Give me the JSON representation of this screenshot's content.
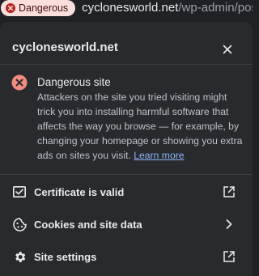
{
  "omnibox": {
    "chip_label": "Dangerous",
    "url_host": "cyclonesworld.net",
    "url_path": "/wp-admin/post"
  },
  "panel": {
    "site_title": "cyclonesworld.net",
    "warning": {
      "title": "Dangerous site",
      "description": "Attackers on the site you tried visiting might trick you into installing harmful software that affects the way you browse — for example, by changing your homepage or showing you extra ads on sites you visit.",
      "learn_more": "Learn more"
    },
    "rows": [
      {
        "label": "Certificate is valid",
        "icon": "certificate-icon",
        "trail": "open-external-icon"
      },
      {
        "label": "Cookies and site data",
        "icon": "cookie-icon",
        "trail": "chevron-right-icon"
      },
      {
        "label": "Site settings",
        "icon": "gear-icon",
        "trail": "open-external-icon"
      }
    ]
  },
  "colors": {
    "background": "#202124",
    "panel": "#292a2d",
    "danger_chip_bg": "#f9dedc",
    "danger_icon": "#f28b82",
    "link": "#8ab4f8"
  }
}
